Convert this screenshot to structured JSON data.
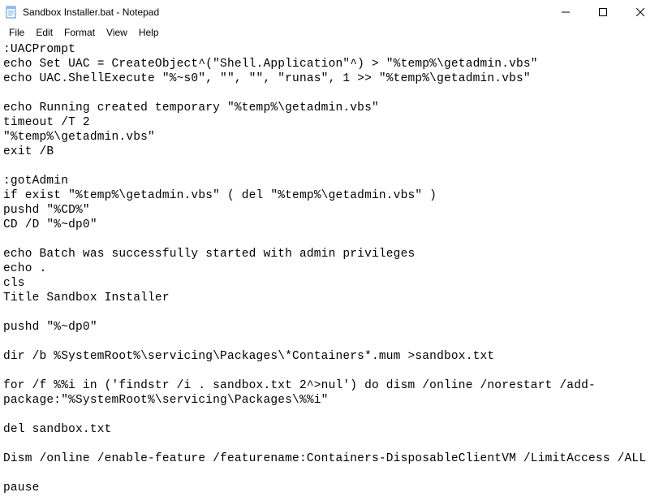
{
  "window": {
    "title": "Sandbox Installer.bat - Notepad",
    "icon": "notepad-icon"
  },
  "menubar": {
    "items": [
      "File",
      "Edit",
      "Format",
      "View",
      "Help"
    ]
  },
  "editor": {
    "content": ":UACPrompt\necho Set UAC = CreateObject^(\"Shell.Application\"^) > \"%temp%\\getadmin.vbs\"\necho UAC.ShellExecute \"%~s0\", \"\", \"\", \"runas\", 1 >> \"%temp%\\getadmin.vbs\"\n\necho Running created temporary \"%temp%\\getadmin.vbs\"\ntimeout /T 2\n\"%temp%\\getadmin.vbs\"\nexit /B\n\n:gotAdmin\nif exist \"%temp%\\getadmin.vbs\" ( del \"%temp%\\getadmin.vbs\" )\npushd \"%CD%\"\nCD /D \"%~dp0\"\n\necho Batch was successfully started with admin privileges\necho .\ncls\nTitle Sandbox Installer\n\npushd \"%~dp0\"\n\ndir /b %SystemRoot%\\servicing\\Packages\\*Containers*.mum >sandbox.txt\n\nfor /f %%i in ('findstr /i . sandbox.txt 2^>nul') do dism /online /norestart /add-package:\"%SystemRoot%\\servicing\\Packages\\%%i\"\n\ndel sandbox.txt\n\nDism /online /enable-feature /featurename:Containers-DisposableClientVM /LimitAccess /ALL\n\npause"
  }
}
